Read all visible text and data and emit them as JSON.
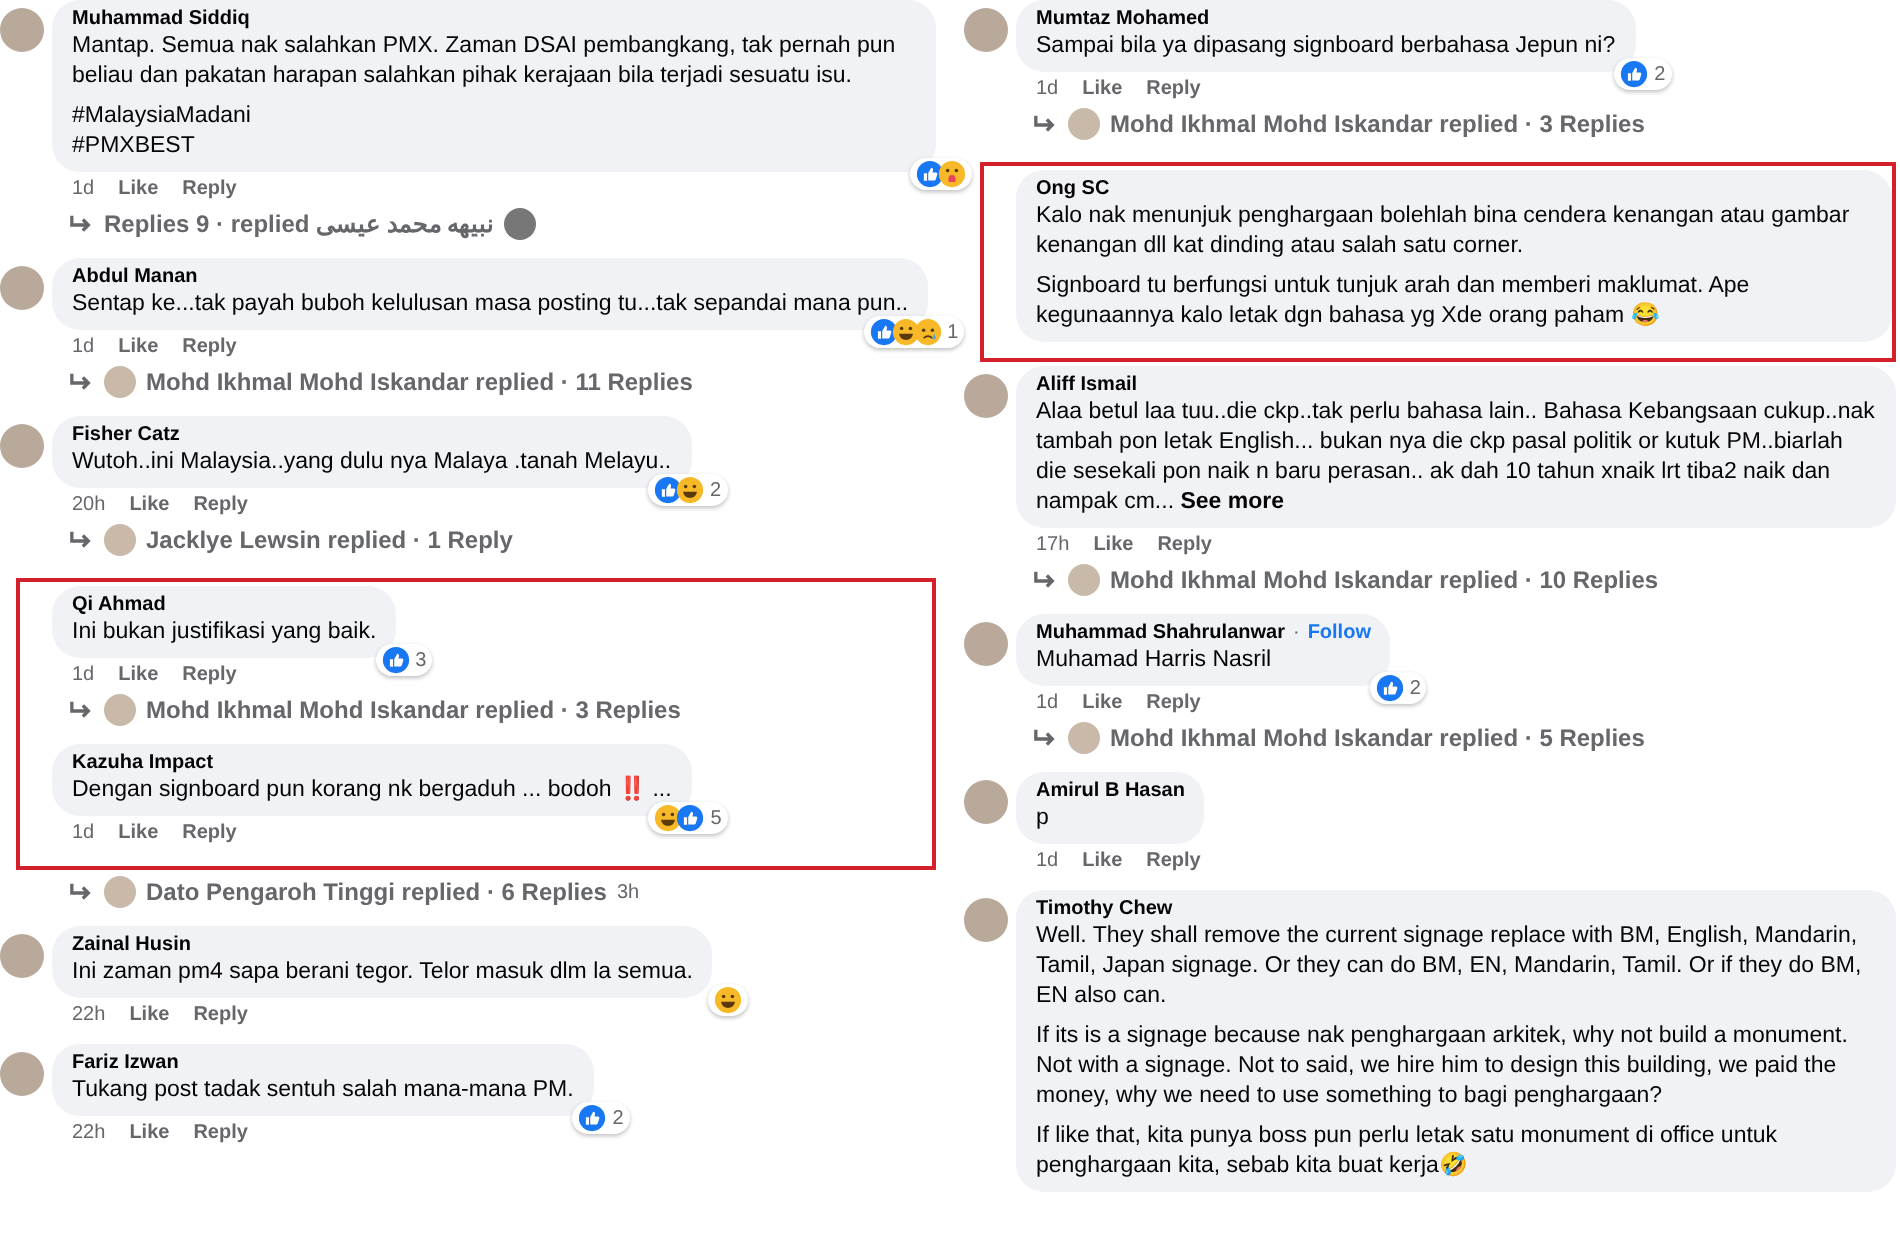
{
  "columns": [
    {
      "blocks": [
        {
          "highlighted": false,
          "comments": [
            {
              "author": "Muhammad Siddiq",
              "paragraphs": [
                "Mantap. Semua nak salahkan PMX. Zaman DSAI pembangkang, tak pernah pun beliau dan pakatan harapan salahkan pihak kerajaan bila terjadi sesuatu isu.",
                "#MalaysiaMadani\n#PMXBEST"
              ],
              "reactions": [
                {
                  "kind": "like"
                },
                {
                  "kind": "care"
                }
              ],
              "time": "1d",
              "like": "Like",
              "reply": "Reply",
              "replies": {
                "kind": "count_first",
                "text": "Replies 9 · replied نبيهه محمد عيسى"
              }
            },
            {
              "author": "Abdul Manan",
              "paragraphs": [
                "Sentap ke...tak payah buboh kelulusan masa posting tu...tak sepandai mana pun.."
              ],
              "reactions": [
                {
                  "kind": "like"
                },
                {
                  "kind": "haha"
                },
                {
                  "kind": "sad"
                }
              ],
              "reaction_count": "1",
              "time": "1d",
              "like": "Like",
              "reply": "Reply",
              "replies": {
                "kind": "user_first",
                "text": "Mohd Ikhmal Mohd Iskandar replied · 11 Replies"
              }
            },
            {
              "author": "Fisher Catz",
              "paragraphs": [
                "Wutoh..ini Malaysia..yang dulu nya Malaya .tanah Melayu.."
              ],
              "reactions": [
                {
                  "kind": "like"
                },
                {
                  "kind": "haha"
                }
              ],
              "reaction_count": "2",
              "time": "20h",
              "like": "Like",
              "reply": "Reply",
              "replies": {
                "kind": "user_first",
                "text": "Jacklye Lewsin replied · 1 Reply"
              }
            }
          ]
        },
        {
          "highlighted": true,
          "comments": [
            {
              "author": "Qi Ahmad",
              "paragraphs": [
                "Ini bukan justifikasi yang baik."
              ],
              "reactions": [
                {
                  "kind": "like"
                }
              ],
              "reaction_count": "3",
              "time": "1d",
              "like": "Like",
              "reply": "Reply",
              "replies": {
                "kind": "user_first",
                "text": "Mohd Ikhmal Mohd Iskandar replied · 3 Replies"
              }
            },
            {
              "author": "Kazuha Impact",
              "paragraphs": [
                "Dengan signboard pun korang nk bergaduh ... bodoh ‼️ ..."
              ],
              "reactions": [
                {
                  "kind": "haha"
                },
                {
                  "kind": "like"
                }
              ],
              "reaction_count": "5",
              "time": "1d",
              "like": "Like",
              "reply": "Reply"
            }
          ]
        },
        {
          "highlighted": false,
          "comments": [
            {
              "replies": {
                "kind": "user_first",
                "text": "Dato Pengaroh Tinggi replied · 6 Replies",
                "time": "3h"
              }
            },
            {
              "author": "Zainal Husin",
              "paragraphs": [
                "Ini zaman pm4 sapa berani tegor. Telor masuk dlm la semua."
              ],
              "reactions": [
                {
                  "kind": "haha"
                }
              ],
              "time": "22h",
              "like": "Like",
              "reply": "Reply"
            },
            {
              "author": "Fariz Izwan",
              "paragraphs": [
                "Tukang post tadak sentuh salah mana-mana PM."
              ],
              "reactions": [
                {
                  "kind": "like"
                }
              ],
              "reaction_count": "2",
              "time": "22h",
              "like": "Like",
              "reply": "Reply"
            }
          ]
        }
      ]
    },
    {
      "blocks": [
        {
          "highlighted": false,
          "comments": [
            {
              "author": "Mumtaz Mohamed",
              "paragraphs": [
                "Sampai bila ya dipasang signboard berbahasa Jepun ni?"
              ],
              "reactions": [
                {
                  "kind": "like"
                }
              ],
              "reaction_count": "2",
              "time": "1d",
              "like": "Like",
              "reply": "Reply",
              "replies": {
                "kind": "user_first",
                "text": "Mohd Ikhmal Mohd Iskandar replied · 3 Replies"
              }
            }
          ]
        },
        {
          "highlighted": true,
          "comments": [
            {
              "author": "Ong SC",
              "paragraphs": [
                "Kalo nak menunjuk penghargaan bolehlah bina cendera kenangan atau gambar kenangan dll kat dinding atau salah satu corner.",
                "Signboard tu berfungsi untuk tunjuk arah dan memberi maklumat. Ape kegunaannya kalo letak dgn bahasa yg Xde orang paham 😂"
              ]
            }
          ]
        },
        {
          "highlighted": false,
          "comments": [
            {
              "author": "Aliff Ismail",
              "paragraphs": [
                "Alaa betul laa tuu..die ckp..tak perlu bahasa lain.. Bahasa Kebangsaan cukup..nak tambah pon letak English... bukan nya die ckp pasal politik or kutuk PM..biarlah die sesekali pon naik n baru perasan.. ak dah 10 tahun xnaik lrt tiba2 naik dan nampak cm... **See more**"
              ],
              "time": "17h",
              "like": "Like",
              "reply": "Reply",
              "replies": {
                "kind": "user_first",
                "text": "Mohd Ikhmal Mohd Iskandar replied · 10 Replies"
              }
            },
            {
              "author": "Muhammad Shahrulanwar",
              "follow_dot": "·",
              "follow": "Follow",
              "paragraphs": [
                "Muhamad Harris Nasril"
              ],
              "reactions": [
                {
                  "kind": "like"
                }
              ],
              "reaction_count": "2",
              "time": "1d",
              "like": "Like",
              "reply": "Reply",
              "replies": {
                "kind": "user_first",
                "text": "Mohd Ikhmal Mohd Iskandar replied · 5 Replies"
              }
            },
            {
              "author": "Amirul B Hasan",
              "paragraphs": [
                "p"
              ],
              "time": "1d",
              "like": "Like",
              "reply": "Reply"
            },
            {
              "author": "Timothy Chew",
              "paragraphs": [
                "Well. They shall remove the current signage replace with BM, English, Mandarin, Tamil, Japan signage. Or they can do BM, EN, Mandarin, Tamil. Or if they do BM, EN also can.",
                "If its is a signage because nak penghargaan arkitek, why not build a monument. Not with a signage. Not to said, we hire him to design this building, we paid the money, why we need to use something to bagi penghargaan?",
                "If like that, kita punya boss pun perlu letak satu monument di office untuk penghargaan kita, sebab kita buat kerja🤣"
              ]
            }
          ]
        }
      ]
    }
  ]
}
